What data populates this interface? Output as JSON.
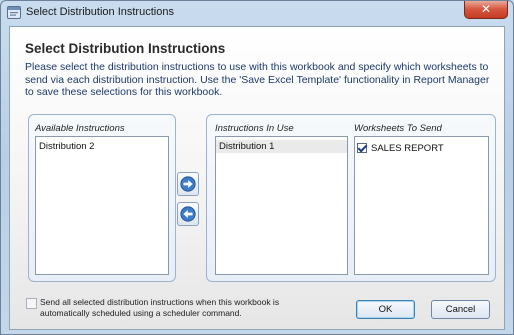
{
  "window": {
    "title": "Select Distribution Instructions",
    "close_glyph": "✕"
  },
  "dialog": {
    "heading": "Select Distribution Instructions",
    "description": "Please select the distribution instructions to use with this workbook and specify which worksheets to send via each distribution instruction. Use the 'Save Excel Template' functionality in Report Manager to save these selections for this workbook."
  },
  "available": {
    "label": "Available Instructions",
    "items": [
      "Distribution 2"
    ]
  },
  "in_use": {
    "label": "Instructions In Use",
    "items": [
      {
        "label": "Distribution 1",
        "selected": true
      }
    ]
  },
  "worksheets": {
    "label": "Worksheets To Send",
    "items": [
      {
        "label": "SALES REPORT",
        "checked": true
      }
    ]
  },
  "transfer": {
    "add_icon": "arrow-right-icon",
    "remove_icon": "arrow-left-icon"
  },
  "footer": {
    "schedule_checked": false,
    "schedule_text": "Send all selected distribution instructions when this workbook is automatically scheduled using a scheduler command.",
    "ok_label": "OK",
    "cancel_label": "Cancel"
  },
  "colors": {
    "accent_blue": "#2f6fb8",
    "close_red": "#c23c22"
  }
}
